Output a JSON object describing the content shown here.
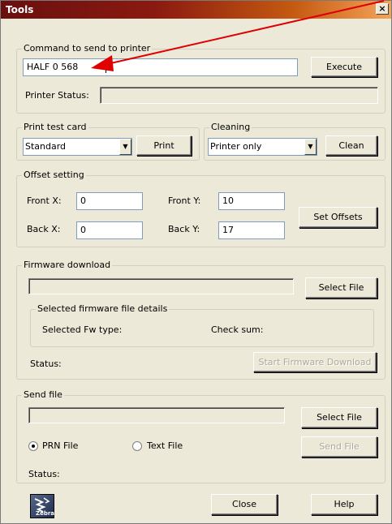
{
  "window": {
    "title": "Tools",
    "close_glyph": "×"
  },
  "command": {
    "group_label": "Command to send to printer",
    "input_value": "HALF 0 568",
    "execute_label": "Execute",
    "status_label": "Printer Status:",
    "status_value": ""
  },
  "test_card": {
    "group_label": "Print test card",
    "selected": "Standard",
    "print_label": "Print"
  },
  "cleaning": {
    "group_label": "Cleaning",
    "selected": "Printer only",
    "clean_label": "Clean"
  },
  "offsets": {
    "group_label": "Offset setting",
    "front_x_label": "Front X:",
    "front_x_value": "0",
    "front_y_label": "Front Y:",
    "front_y_value": "10",
    "back_x_label": "Back X:",
    "back_x_value": "0",
    "back_y_label": "Back Y:",
    "back_y_value": "17",
    "set_label": "Set Offsets"
  },
  "firmware": {
    "group_label": "Firmware download",
    "select_label": "Select File",
    "details_label": "Selected firmware file details",
    "fw_type_label": "Selected Fw type:",
    "checksum_label": "Check sum:",
    "status_label": "Status:",
    "start_label": "Start Firmware Download"
  },
  "send_file": {
    "group_label": "Send file",
    "select_label": "Select File",
    "prn_label": "PRN File",
    "text_label": "Text File",
    "send_label": "Send File",
    "status_label": "Status:"
  },
  "footer": {
    "logo_text": "Zebra",
    "close_label": "Close",
    "help_label": "Help"
  },
  "colors": {
    "window_bg": "#ece9d8",
    "annotation_arrow": "#e00000"
  },
  "icons": {
    "logo": "zebra-logo-icon",
    "dropdown": "chevron-down-icon",
    "arrow": "annotation-arrow-icon"
  }
}
